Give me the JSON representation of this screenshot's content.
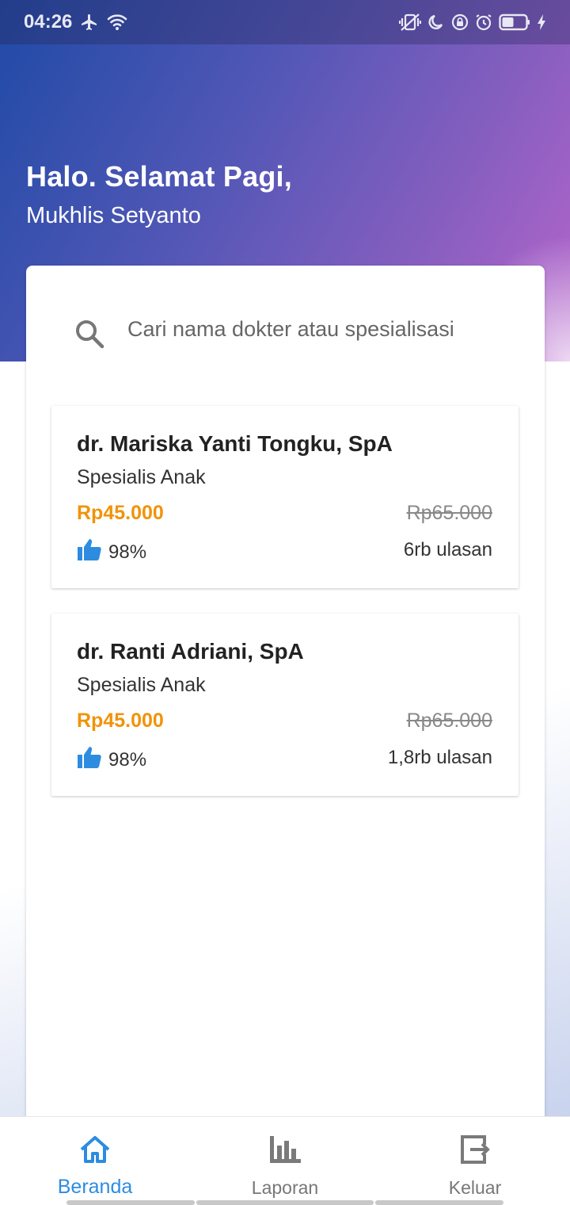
{
  "status_bar": {
    "time": "04:26",
    "icons": [
      "airplane-icon",
      "wifi-icon",
      "vibrate-icon",
      "moon-icon",
      "lock-rotation-icon",
      "alarm-icon",
      "battery-icon",
      "charging-icon"
    ]
  },
  "header": {
    "greeting": "Halo. Selamat Pagi,",
    "user_name": "Mukhlis Setyanto",
    "gradient_colors": [
      "#1f4aa6",
      "#8a5fc0",
      "#b865cc"
    ]
  },
  "search": {
    "placeholder": "Cari nama dokter atau spesialisasi",
    "value": ""
  },
  "doctors": [
    {
      "name": "dr. Mariska Yanti Tongku, SpA",
      "specialty": "Spesialis Anak",
      "price": "Rp45.000",
      "original_price": "Rp65.000",
      "rating": "98%",
      "reviews": "6rb ulasan"
    },
    {
      "name": "dr. Ranti Adriani, SpA",
      "specialty": "Spesialis Anak",
      "price": "Rp45.000",
      "original_price": "Rp65.000",
      "rating": "98%",
      "reviews": "1,8rb ulasan"
    }
  ],
  "bottom_nav": {
    "items": [
      {
        "label": "Beranda",
        "icon": "home-icon",
        "active": true
      },
      {
        "label": "Laporan",
        "icon": "bar-chart-icon",
        "active": false
      },
      {
        "label": "Keluar",
        "icon": "exit-icon",
        "active": false
      }
    ]
  },
  "colors": {
    "accent": "#2d8ce0",
    "price": "#f0930a",
    "thumb": "#2d8ce0"
  }
}
